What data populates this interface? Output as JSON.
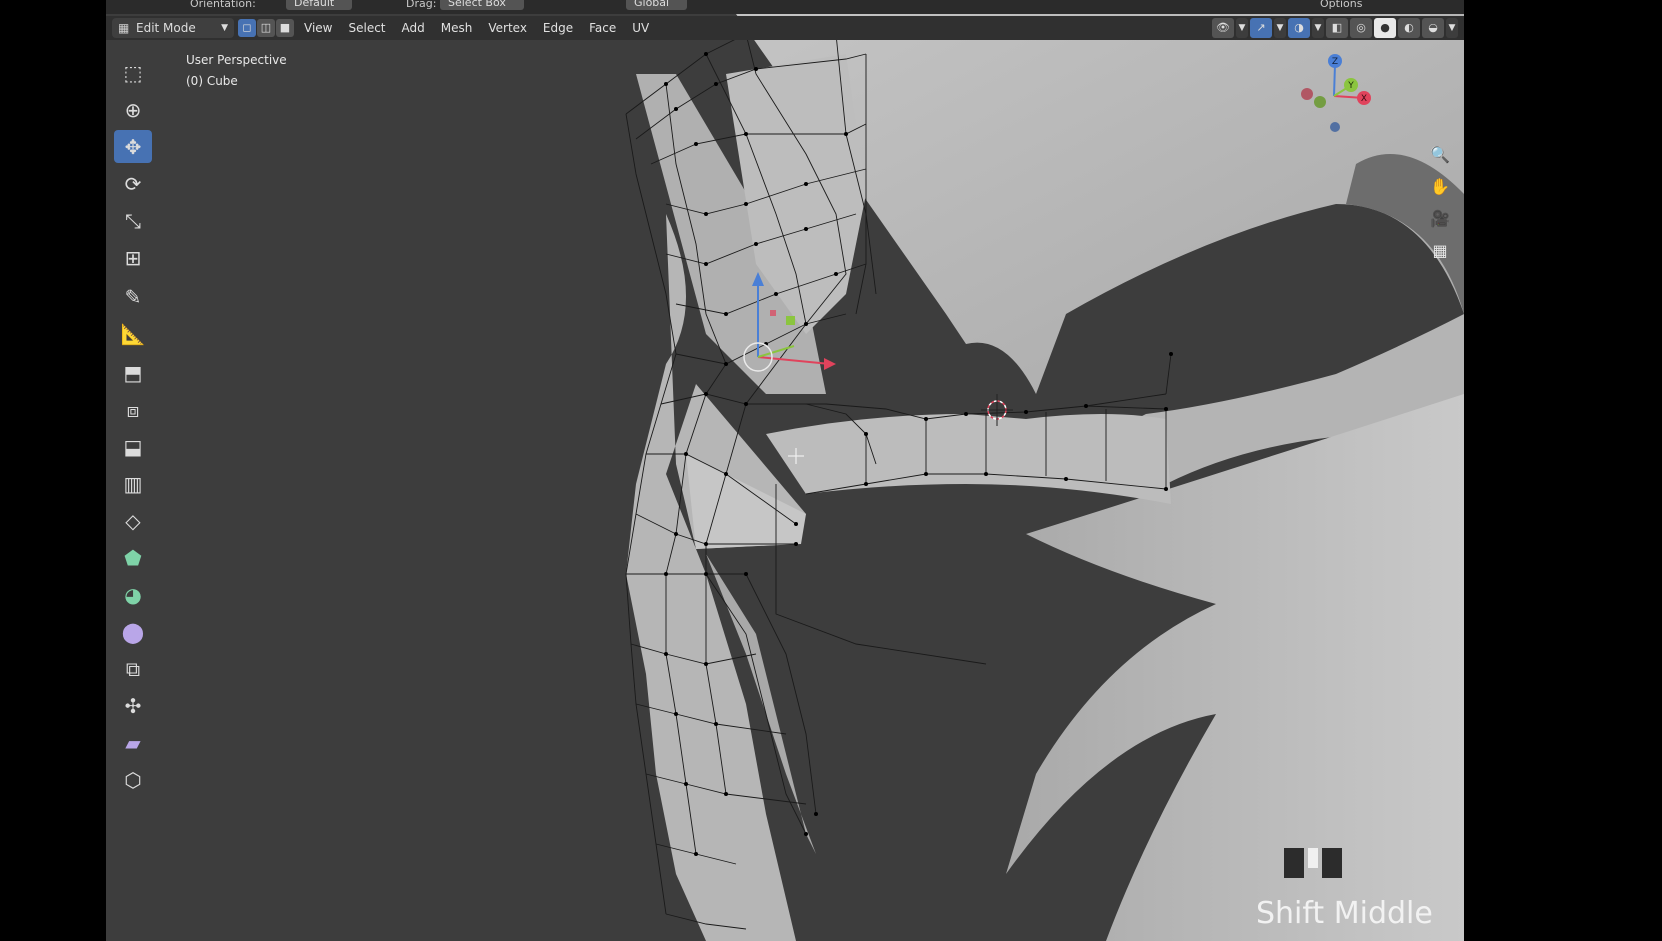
{
  "tool_settings": {
    "orientation_label": "Orientation:",
    "orientation_value": "Default",
    "drag_label": "Drag:",
    "drag_value": "Select Box",
    "transform_orientation": "Global",
    "options_label": "Options"
  },
  "header": {
    "mode": "Edit Mode",
    "select_modes": [
      "vertex",
      "edge",
      "face"
    ],
    "active_select_mode": "vertex",
    "menu": [
      "View",
      "Select",
      "Add",
      "Mesh",
      "Vertex",
      "Edge",
      "Face",
      "UV"
    ]
  },
  "toolbar": {
    "tools": [
      {
        "name": "select-box",
        "icon": "cursor-box-icon"
      },
      {
        "name": "cursor",
        "icon": "crosshair-circle-icon"
      },
      {
        "name": "move",
        "icon": "move-arrows-icon",
        "active": true
      },
      {
        "name": "rotate",
        "icon": "rotate-icon"
      },
      {
        "name": "scale",
        "icon": "scale-icon"
      },
      {
        "name": "transform",
        "icon": "transform-icon"
      },
      {
        "name": "annotate",
        "icon": "pencil-icon"
      },
      {
        "name": "measure",
        "icon": "ruler-icon"
      },
      {
        "name": "extrude-region",
        "icon": "extrude-icon"
      },
      {
        "name": "inset-faces",
        "icon": "inset-icon"
      },
      {
        "name": "bevel",
        "icon": "bevel-icon"
      },
      {
        "name": "loop-cut",
        "icon": "loop-cut-icon"
      },
      {
        "name": "knife",
        "icon": "knife-icon"
      },
      {
        "name": "poly-build",
        "icon": "poly-build-icon"
      },
      {
        "name": "spin",
        "icon": "spin-icon"
      },
      {
        "name": "smooth",
        "icon": "smooth-icon"
      },
      {
        "name": "edge-slide",
        "icon": "edge-slide-icon"
      },
      {
        "name": "shrink-fatten",
        "icon": "shrink-fatten-icon"
      },
      {
        "name": "shear",
        "icon": "shear-icon"
      },
      {
        "name": "rip-region",
        "icon": "rip-icon"
      }
    ]
  },
  "viewport": {
    "view_name": "User Perspective",
    "object_info": "(0) Cube"
  },
  "gizmo": {
    "x": "X",
    "y": "Y",
    "z": "Z"
  },
  "key_overlay": {
    "text": "Shift Middle"
  },
  "colors": {
    "accent": "#4772b3",
    "viewport_bg": "#3d3d3d",
    "header_bg": "#303030",
    "mesh_fill": "#b9b9b9",
    "axis_x": "#e0435c",
    "axis_y": "#8bc53f",
    "axis_z": "#4a7fd6"
  }
}
